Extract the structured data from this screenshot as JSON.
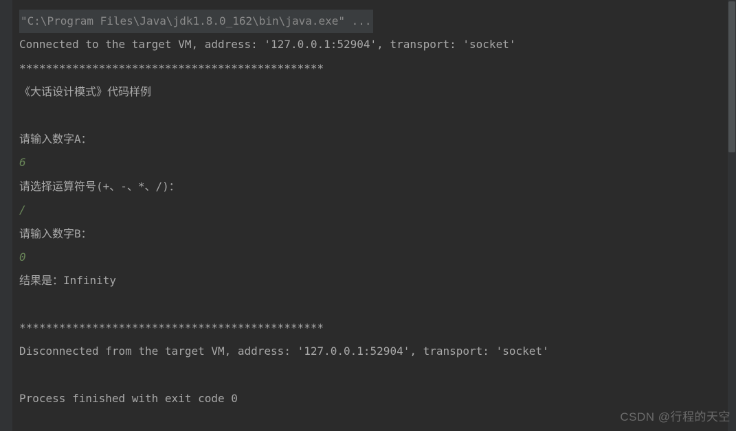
{
  "console": {
    "command_line": "\"C:\\Program Files\\Java\\jdk1.8.0_162\\bin\\java.exe\" ...",
    "connected_msg": "Connected to the target VM, address: '127.0.0.1:52904', transport: 'socket'",
    "separator1": "**********************************************",
    "title_line": "《大话设计模式》代码样例",
    "prompt_a": "请输入数字A：",
    "input_a": "6",
    "prompt_op": "请选择运算符号(+、-、*、/)：",
    "input_op": "/",
    "prompt_b": "请输入数字B：",
    "input_b": "0",
    "result": "结果是：Infinity",
    "separator2": "**********************************************",
    "disconnected_msg": "Disconnected from the target VM, address: '127.0.0.1:52904', transport: 'socket'",
    "exit_msg": "Process finished with exit code 0"
  },
  "watermark": "CSDN @行程的天空"
}
